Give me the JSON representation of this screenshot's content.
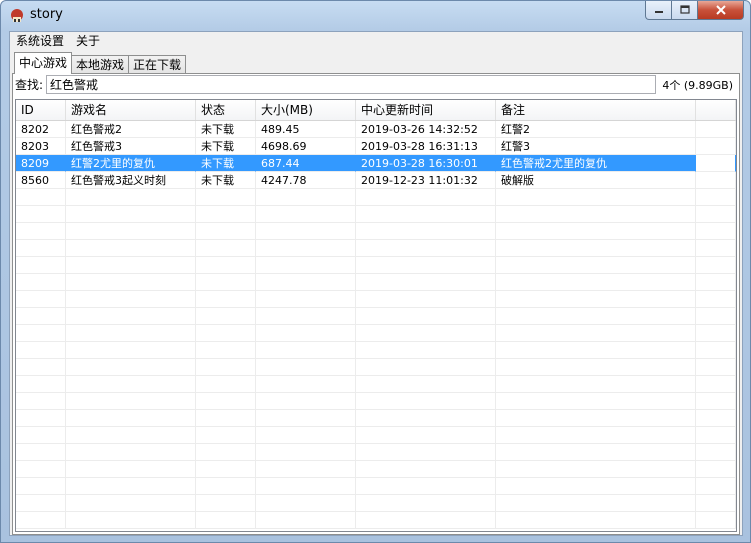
{
  "window": {
    "title": "story",
    "colors": {
      "selection": "#3399ff",
      "titlebar": "#c7dcf2",
      "close_button": "#c8513a"
    }
  },
  "menu": [
    {
      "label": "系统设置"
    },
    {
      "label": "关于"
    }
  ],
  "tabs": [
    {
      "label": "中心游戏",
      "active": true
    },
    {
      "label": "本地游戏",
      "active": false
    },
    {
      "label": "正在下载",
      "active": false
    }
  ],
  "search": {
    "label": "查找:",
    "value": "红色警戒",
    "count": "4个 (9.89GB)"
  },
  "table": {
    "columns": [
      "ID",
      "游戏名",
      "状态",
      "大小(MB)",
      "中心更新时间",
      "备注"
    ],
    "rows": [
      {
        "cells": [
          "8202",
          "红色警戒2",
          "未下载",
          "489.45",
          "2019-03-26 14:32:52",
          "红警2"
        ],
        "selected": false
      },
      {
        "cells": [
          "8203",
          "红色警戒3",
          "未下载",
          "4698.69",
          "2019-03-28 16:31:13",
          "红警3"
        ],
        "selected": false
      },
      {
        "cells": [
          "8209",
          "红警2尤里的复仇",
          "未下载",
          "687.44",
          "2019-03-28 16:30:01",
          "红色警戒2尤里的复仇"
        ],
        "selected": true
      },
      {
        "cells": [
          "8560",
          "红色警戒3起义时刻",
          "未下载",
          "4247.78",
          "2019-12-23 11:01:32",
          "破解版"
        ],
        "selected": false
      }
    ]
  }
}
